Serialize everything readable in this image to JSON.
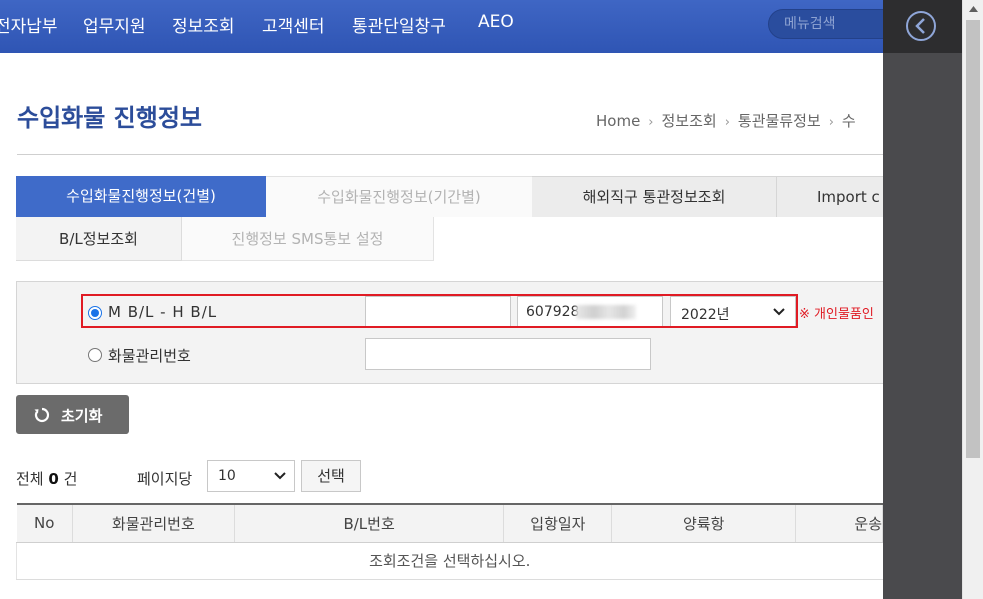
{
  "nav": {
    "items": [
      "전자납부",
      "업무지원",
      "정보조회",
      "고객센터",
      "통관단일창구",
      "AEO"
    ],
    "search_placeholder": "메뉴검색"
  },
  "page": {
    "title": "수입화물 진행정보",
    "breadcrumb": [
      "Home",
      "정보조회",
      "통관물류정보",
      "수"
    ]
  },
  "tabs": [
    {
      "label": "수입화물진행정보(건별)",
      "state": "active"
    },
    {
      "label": "수입화물진행정보(기간별)",
      "state": "disabled"
    },
    {
      "label": "해외직구 통관정보조회",
      "state": "normal"
    },
    {
      "label": "Import c",
      "state": "normal"
    }
  ],
  "subtabs": [
    {
      "label": "B/L정보조회",
      "state": "active"
    },
    {
      "label": "진행정보 SMS통보 설정",
      "state": "disabled"
    }
  ],
  "search": {
    "option_mbl_label": "M B/L - H B/L",
    "option_mbl_checked": true,
    "mbl_value": "",
    "hbl_value": "607928",
    "year_value": "2022년",
    "notice": "※ 개인물품인",
    "option_cargo_label": "화물관리번호",
    "cargo_value": ""
  },
  "reset_label": "초기화",
  "results": {
    "total_prefix": "전체",
    "total_count": "0",
    "total_suffix": "건",
    "per_page_label": "페이지당",
    "per_page_value": "10",
    "select_label": "선택",
    "columns": [
      "No",
      "화물관리번호",
      "B/L번호",
      "입항일자",
      "양륙항",
      "운송"
    ],
    "empty_message": "조회조건을 선택하십시오."
  },
  "colors": {
    "nav_bg": "#3a60c0",
    "accent": "#3f6bc9",
    "highlight_border": "#e01b24",
    "side_panel": "#4a4a4d"
  },
  "icons": {
    "back": "circle-chevron-left-icon",
    "reset": "refresh-icon",
    "dropdown": "chevron-down-icon"
  }
}
